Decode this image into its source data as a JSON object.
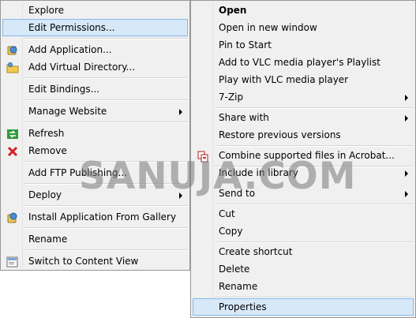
{
  "left_menu": {
    "items": [
      {
        "label": "Explore"
      },
      {
        "label": "Edit Permissions..."
      },
      {
        "label": "Add Application..."
      },
      {
        "label": "Add Virtual Directory..."
      },
      {
        "label": "Edit Bindings..."
      },
      {
        "label": "Manage Website"
      },
      {
        "label": "Refresh"
      },
      {
        "label": "Remove"
      },
      {
        "label": "Add FTP Publishing..."
      },
      {
        "label": "Deploy"
      },
      {
        "label": "Install Application From Gallery"
      },
      {
        "label": "Rename"
      },
      {
        "label": "Switch to Content View"
      }
    ]
  },
  "right_menu": {
    "items": [
      {
        "label": "Open"
      },
      {
        "label": "Open in new window"
      },
      {
        "label": "Pin to Start"
      },
      {
        "label": "Add to VLC media player's Playlist"
      },
      {
        "label": "Play with VLC media player"
      },
      {
        "label": "7-Zip"
      },
      {
        "label": "Share with"
      },
      {
        "label": "Restore previous versions"
      },
      {
        "label": "Combine supported files in Acrobat..."
      },
      {
        "label": "Include in library"
      },
      {
        "label": "Send to"
      },
      {
        "label": "Cut"
      },
      {
        "label": "Copy"
      },
      {
        "label": "Create shortcut"
      },
      {
        "label": "Delete"
      },
      {
        "label": "Rename"
      },
      {
        "label": "Properties"
      }
    ]
  },
  "watermark": "SANUJA.COM",
  "colors": {
    "menu_bg": "#f0f0f0",
    "selected_bg": "#d7e8f8",
    "selected_border": "#84b9ea"
  }
}
